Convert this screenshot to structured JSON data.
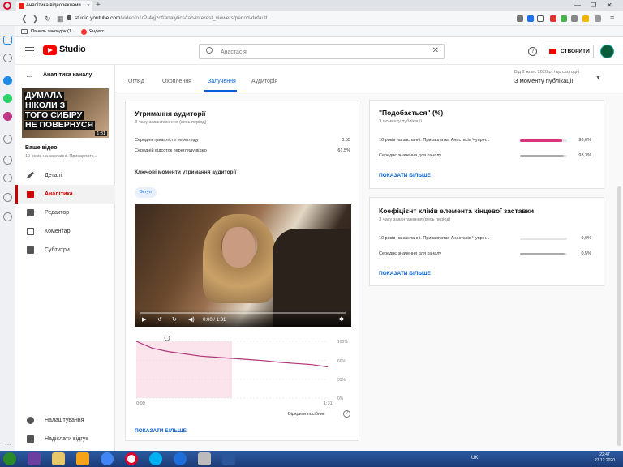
{
  "browser": {
    "tab_title": "Аналітика відеореклами",
    "tab_close": "×",
    "new_tab": "+",
    "url_host": "studio.youtube.com",
    "url_path": "/video/o1rP-4qjzqf/analytics/tab-interest_viewers/period-default",
    "bookmarks": [
      {
        "label": "Панель закладок (1..."
      },
      {
        "label": "Яндекс"
      }
    ]
  },
  "header": {
    "studio_label": "Studio",
    "search_placeholder": "Анастасія",
    "create_label": "СТВОРИТИ"
  },
  "sidebar": {
    "title": "Аналітика каналу",
    "thumb_lines": [
      "ДУМАЛА",
      "НІКОЛИ З",
      "ТОГО СИБІРУ",
      "НЕ ПОВЕРНУСЯ"
    ],
    "thumb_duration": "1:31",
    "your_video": "Ваше відео",
    "video_subtitle": "10 років на засланні. Прикарпатк...",
    "items": [
      {
        "label": "Деталі",
        "icon": "pencil-icon"
      },
      {
        "label": "Аналітика",
        "icon": "analytics-icon"
      },
      {
        "label": "Редактор",
        "icon": "editor-icon"
      },
      {
        "label": "Коментарі",
        "icon": "comments-icon"
      },
      {
        "label": "Субтитри",
        "icon": "subtitles-icon"
      }
    ],
    "bottom_items": [
      {
        "label": "Налаштування",
        "icon": "gear-icon"
      },
      {
        "label": "Надіслати відгук",
        "icon": "feedback-icon"
      }
    ]
  },
  "tabs": [
    {
      "label": "Огляд"
    },
    {
      "label": "Охоплення"
    },
    {
      "label": "Залучення"
    },
    {
      "label": "Аудиторія"
    }
  ],
  "period": {
    "subtitle": "Від 2 жовт. 2020 р. і до сьогодні",
    "value": "З моменту публікації"
  },
  "retention": {
    "title": "Утримання аудиторії",
    "subtitle": "З часу завантаження (весь період)",
    "rows": [
      {
        "label": "Середня тривалість перегляду",
        "value": "0:55"
      },
      {
        "label": "Середній відсоток перегляду відео",
        "value": "61,5%"
      }
    ],
    "key_moments": "Ключові моменти утримання аудиторії",
    "chip": "Вступ",
    "player_time": "0:00 / 1:31",
    "x_start": "0:00",
    "x_end": "1:31",
    "y_labels": [
      "100%",
      "66%",
      "33%",
      "0%"
    ],
    "open_guide": "Відкрити посібник",
    "show_more": "ПОКАЗАТИ БІЛЬШЕ"
  },
  "likes": {
    "title": "\"Подобається\" (%)",
    "subtitle": "З моменту публікації",
    "rows": [
      {
        "label": "10 років на засланні. Прикарпатка Анастасія Чупрін...",
        "value": "90,0%",
        "fraction": 0.9,
        "color": "#d6387b"
      },
      {
        "label": "Середнє значення для каналу",
        "value": "93,3%",
        "fraction": 0.933,
        "color": "#aaaaaa"
      }
    ],
    "show_more": "ПОКАЗАТИ БІЛЬШЕ"
  },
  "endscreen": {
    "title": "Коефіцієнт кліків елемента кінцевої заставки",
    "subtitle": "З часу завантаження (весь період)",
    "rows": [
      {
        "label": "10 років на засланні. Прикарпатка Анастасія Чупрін...",
        "value": "0,0%",
        "fraction": 0.0,
        "color": "#d6387b"
      },
      {
        "label": "Середнє значення для каналу",
        "value": "0,5%",
        "fraction": 0.95,
        "color": "#aaaaaa"
      }
    ],
    "show_more": "ПОКАЗАТИ БІЛЬШЕ"
  },
  "chart_data": {
    "type": "line",
    "x": [
      "0:00",
      "0:05",
      "0:10",
      "0:15",
      "0:20",
      "0:25",
      "0:30",
      "0:40",
      "0:50",
      "1:00",
      "1:10",
      "1:20",
      "1:31"
    ],
    "series": [
      {
        "values": [
          100,
          88,
          82,
          78,
          74,
          72,
          70,
          68,
          66,
          63,
          61,
          59,
          55
        ]
      }
    ],
    "ylim": [
      0,
      100
    ],
    "highlight_range": [
      "0:00",
      "0:30"
    ]
  },
  "taskbar": {
    "lang": "UK",
    "time": "22:47",
    "date": "27.12.2020"
  }
}
